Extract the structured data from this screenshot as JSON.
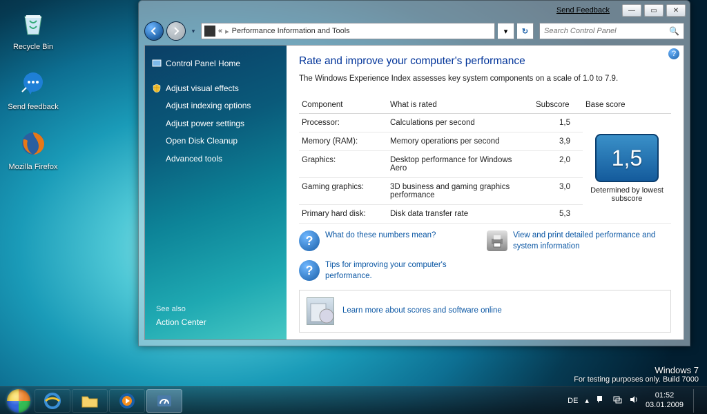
{
  "desktop_icons": [
    {
      "name": "recycle-bin",
      "label": "Recycle Bin"
    },
    {
      "name": "send-feedback-shortcut",
      "label": "Send feedback"
    },
    {
      "name": "firefox-shortcut",
      "label": "Mozilla Firefox"
    }
  ],
  "window": {
    "send_feedback": "Send Feedback",
    "breadcrumb_prefix": "«",
    "breadcrumb": "Performance Information and Tools",
    "search_placeholder": "Search Control Panel"
  },
  "sidebar": {
    "home": "Control Panel Home",
    "items": [
      "Adjust visual effects",
      "Adjust indexing options",
      "Adjust power settings",
      "Open Disk Cleanup",
      "Advanced tools"
    ],
    "see_also": "See also",
    "action_center": "Action Center"
  },
  "content": {
    "title": "Rate and improve your computer's performance",
    "subtitle": "The Windows Experience Index assesses key system components on a scale of 1.0 to 7.9.",
    "headers": {
      "component": "Component",
      "rated": "What is rated",
      "subscore": "Subscore",
      "base": "Base score"
    },
    "rows": [
      {
        "component": "Processor:",
        "rated": "Calculations per second",
        "subscore": "1,5"
      },
      {
        "component": "Memory (RAM):",
        "rated": "Memory operations per second",
        "subscore": "3,9"
      },
      {
        "component": "Graphics:",
        "rated": "Desktop performance for Windows Aero",
        "subscore": "2,0"
      },
      {
        "component": "Gaming graphics:",
        "rated": "3D business and gaming graphics performance",
        "subscore": "3,0"
      },
      {
        "component": "Primary hard disk:",
        "rated": "Disk data transfer rate",
        "subscore": "5,3"
      }
    ],
    "base_score": "1,5",
    "base_label": "Determined by lowest subscore",
    "links": {
      "what_numbers": "What do these numbers mean?",
      "tips": "Tips for improving your computer's performance.",
      "view_print": "View and print detailed performance and system information",
      "learn_online": "Learn more about scores and software online"
    }
  },
  "watermark": {
    "line1": "Windows  7",
    "line2": "For testing purposes only. Build 7000"
  },
  "taskbar": {
    "lang": "DE",
    "time": "01:52",
    "date": "03.01.2009"
  }
}
